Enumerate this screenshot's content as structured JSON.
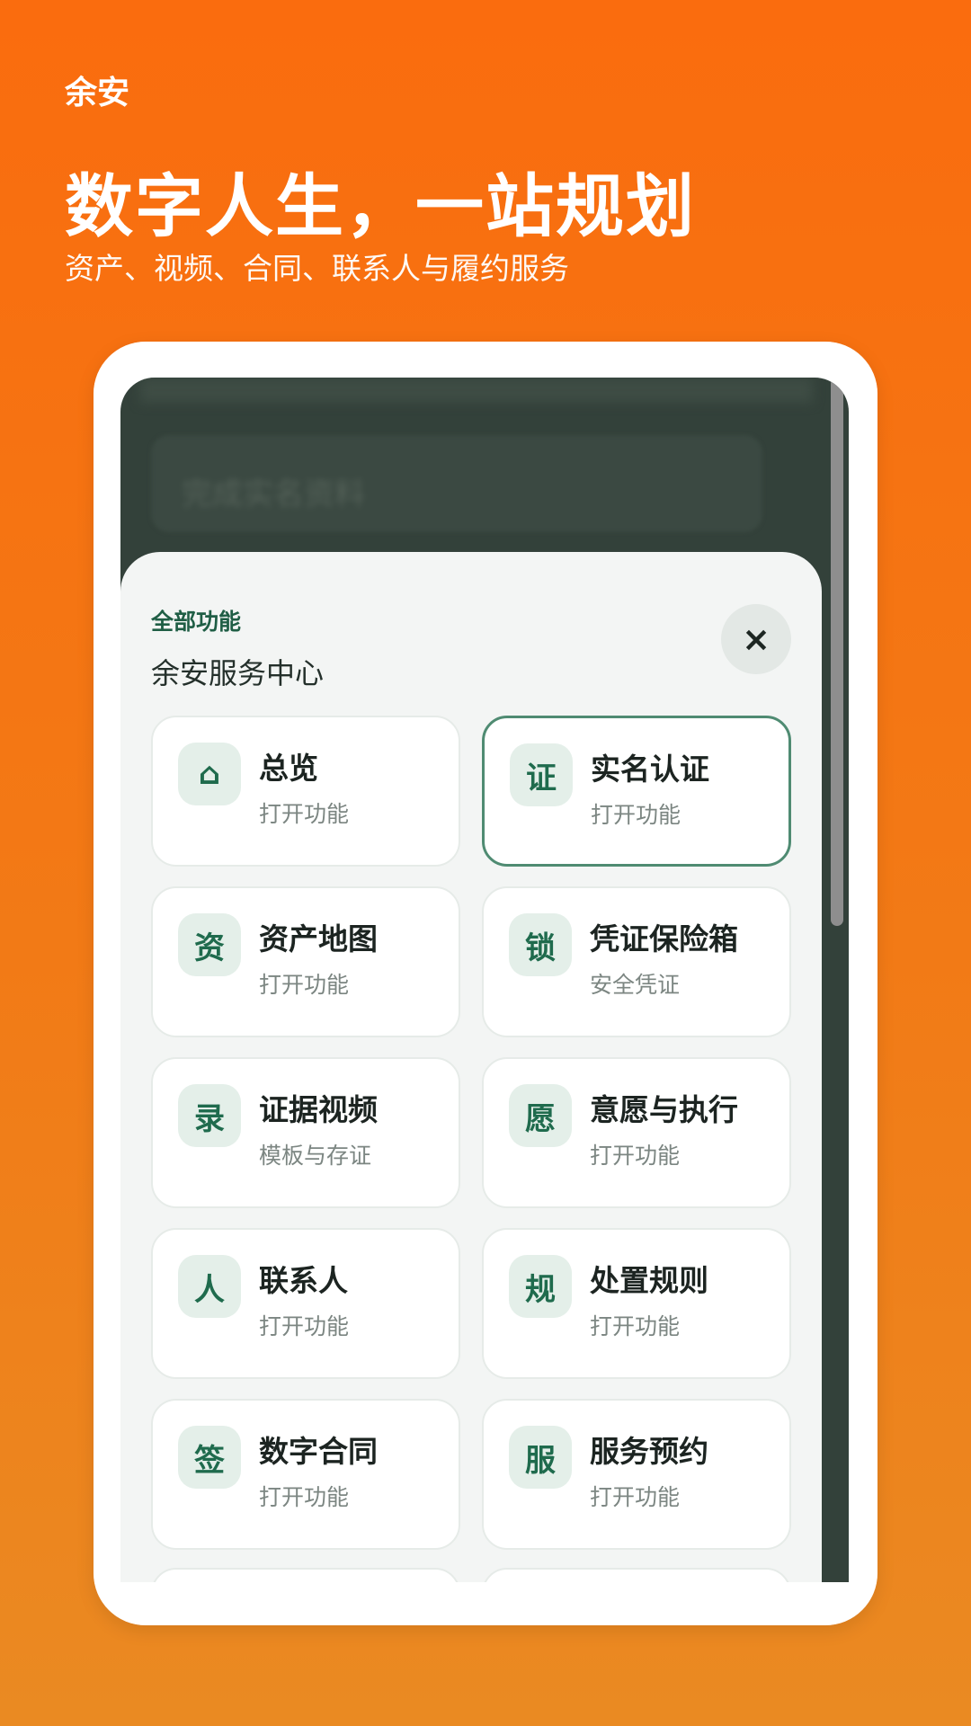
{
  "brand": "余安",
  "headline": "数字人生，一站规划",
  "subhead": "资产、视频、合同、联系人与履约服务",
  "background_blurred_text": "完成实名资料",
  "sheet": {
    "kicker": "全部功能",
    "title": "余安服务中心",
    "close_icon": "×"
  },
  "features": [
    {
      "icon": "⌂",
      "icon_name": "home-icon",
      "title": "总览",
      "sub": "打开功能",
      "selected": false
    },
    {
      "icon": "证",
      "icon_name": "id-verification-icon",
      "title": "实名认证",
      "sub": "打开功能",
      "selected": true
    },
    {
      "icon": "资",
      "icon_name": "asset-map-icon",
      "title": "资产地图",
      "sub": "打开功能",
      "selected": false
    },
    {
      "icon": "锁",
      "icon_name": "vault-lock-icon",
      "title": "凭证保险箱",
      "sub": "安全凭证",
      "selected": false
    },
    {
      "icon": "录",
      "icon_name": "evidence-video-icon",
      "title": "证据视频",
      "sub": "模板与存证",
      "selected": false
    },
    {
      "icon": "愿",
      "icon_name": "wishes-icon",
      "title": "意愿与执行",
      "sub": "打开功能",
      "selected": false
    },
    {
      "icon": "人",
      "icon_name": "contacts-icon",
      "title": "联系人",
      "sub": "打开功能",
      "selected": false
    },
    {
      "icon": "规",
      "icon_name": "rules-icon",
      "title": "处置规则",
      "sub": "打开功能",
      "selected": false
    },
    {
      "icon": "签",
      "icon_name": "contract-sign-icon",
      "title": "数字合同",
      "sub": "打开功能",
      "selected": false
    },
    {
      "icon": "服",
      "icon_name": "service-booking-icon",
      "title": "服务预约",
      "sub": "打开功能",
      "selected": false
    }
  ],
  "colors": {
    "background_top": "#fa6c0e",
    "background_bottom": "#ea8a22",
    "accent_green": "#1f6b4d",
    "selected_border": "#4f8b72"
  }
}
